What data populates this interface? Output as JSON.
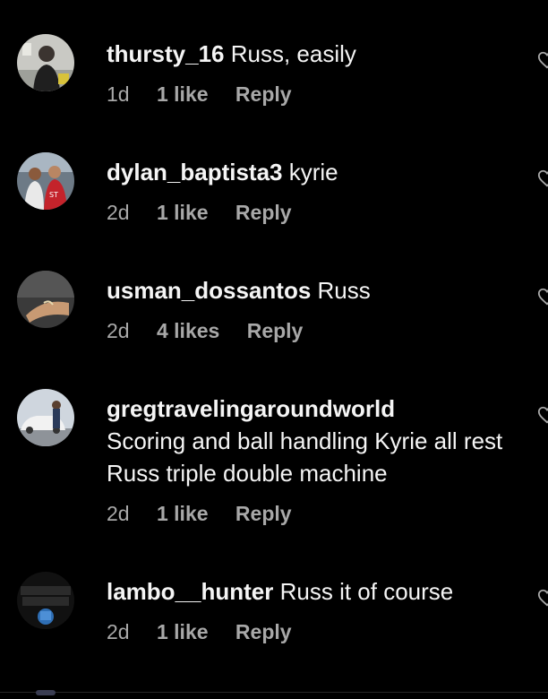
{
  "comments": [
    {
      "username": "thursty_16",
      "text": "Russ, easily",
      "time": "1d",
      "likes": "1 like",
      "reply": "Reply",
      "avatar": "avatar-photo-person-thursty",
      "icon": "heart-icon"
    },
    {
      "username": "dylan_baptista3",
      "text": "kyrie",
      "time": "2d",
      "likes": "1 like",
      "reply": "Reply",
      "avatar": "avatar-photo-runners",
      "icon": "heart-icon"
    },
    {
      "username": "usman_dossantos",
      "text": "Russ",
      "time": "2d",
      "likes": "4 likes",
      "reply": "Reply",
      "avatar": "avatar-photo-wrist",
      "icon": "heart-icon"
    },
    {
      "username": "gregtravelingaroundworld",
      "text": "Scoring and ball handling Kyrie all rest Russ triple double machine",
      "time": "2d",
      "likes": "1 like",
      "reply": "Reply",
      "avatar": "avatar-photo-car",
      "icon": "heart-icon"
    },
    {
      "username": "lambo__hunter",
      "text": "Russ it of course",
      "time": "2d",
      "likes": "1 like",
      "reply": "Reply",
      "avatar": "avatar-logo-hunter",
      "icon": "heart-icon"
    }
  ],
  "colors": {
    "background": "#000000",
    "primary_text": "#f5f5f5",
    "secondary_text": "#a8a8a8"
  }
}
